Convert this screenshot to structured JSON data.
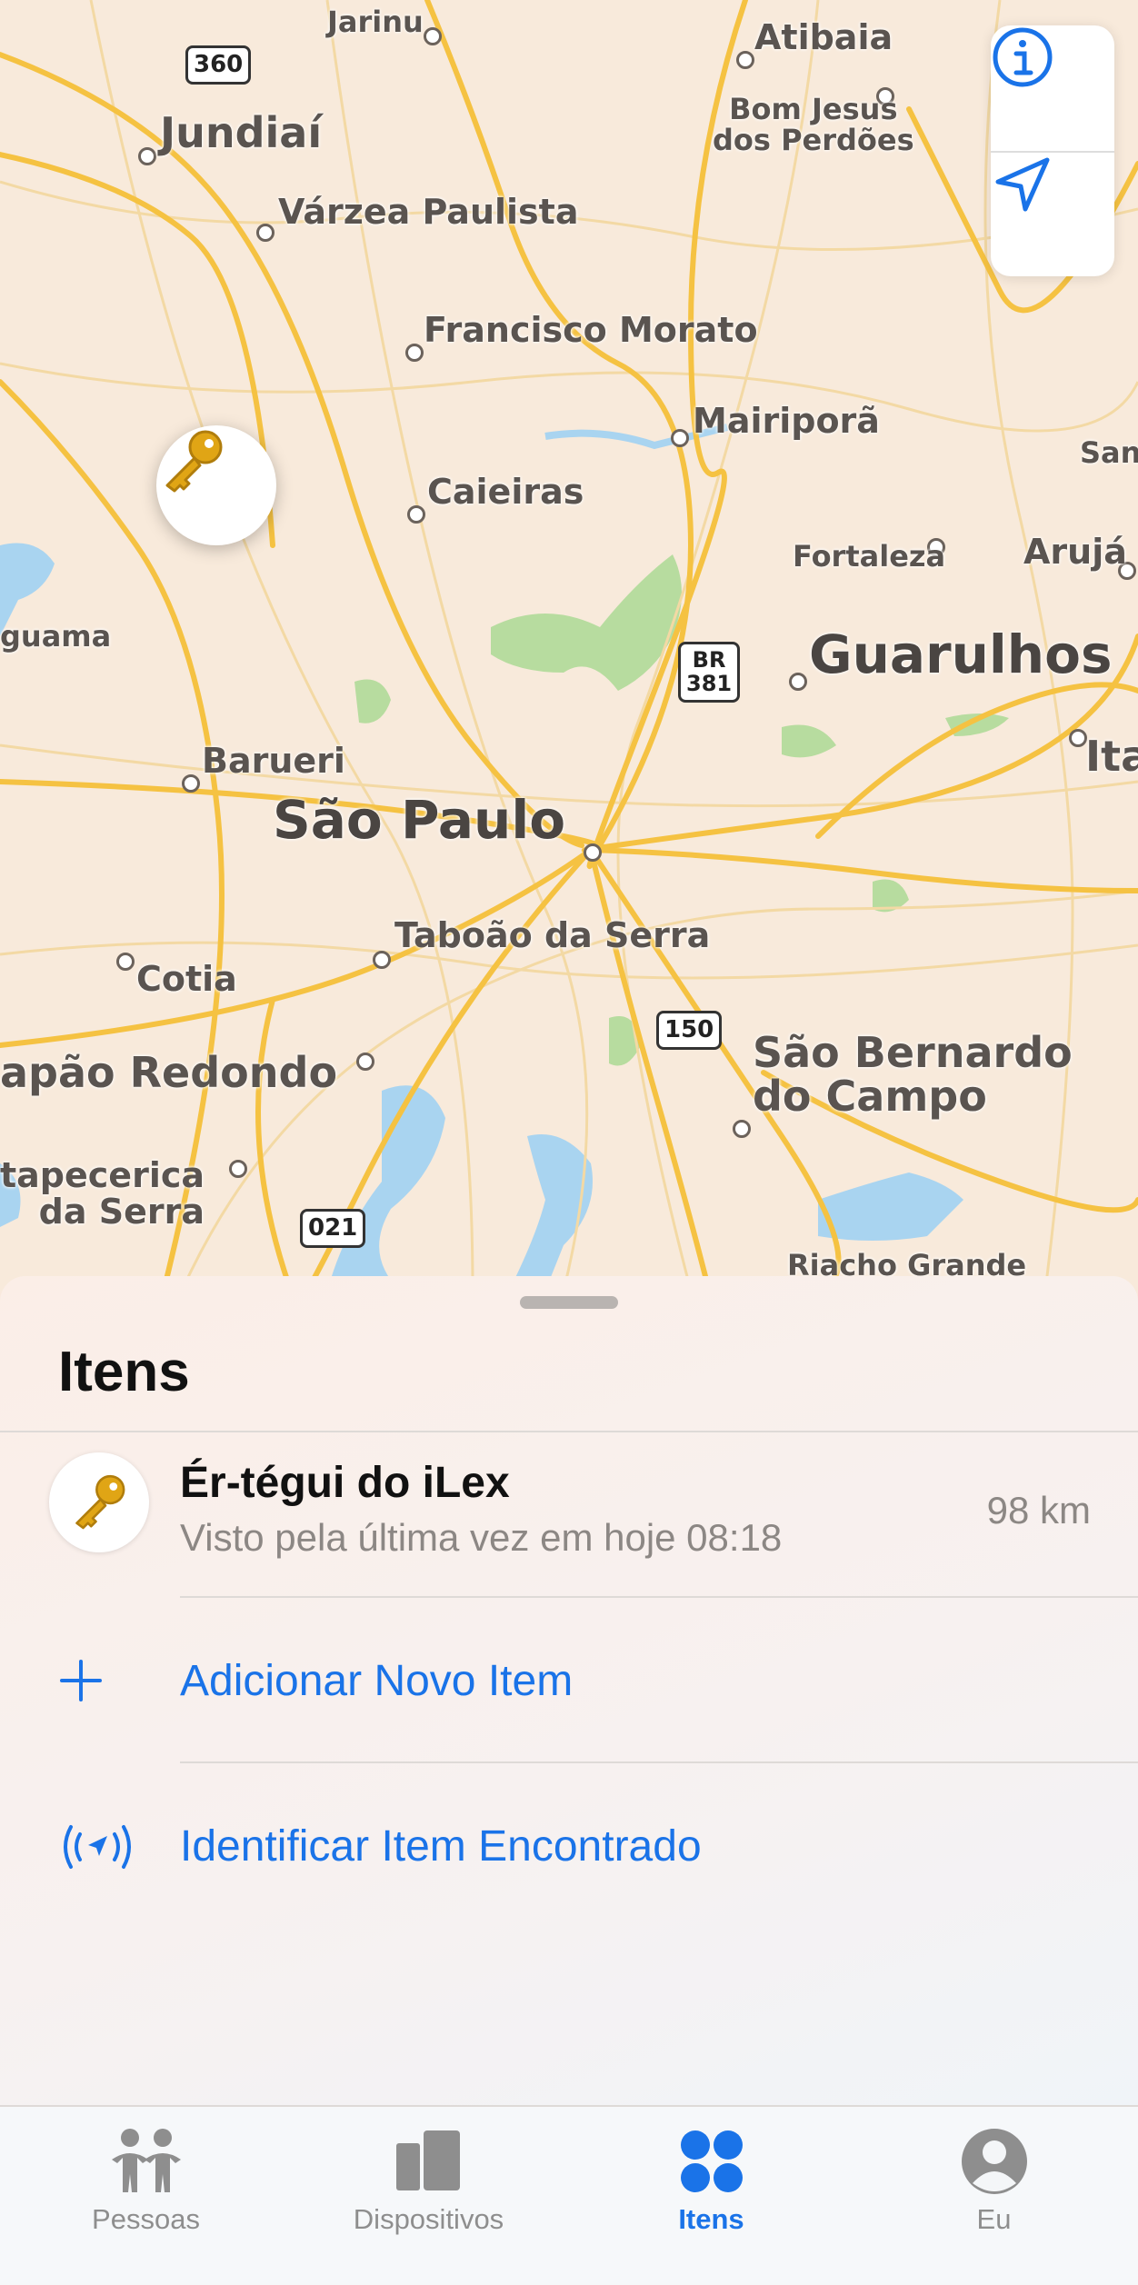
{
  "map": {
    "cities": [
      {
        "name": "Jarinu",
        "size": "s"
      },
      {
        "name": "Atibaia",
        "size": "m"
      },
      {
        "name": "Bom Jesus\ndos Perdões",
        "size": "s"
      },
      {
        "name": "Jundiaí",
        "size": "l"
      },
      {
        "name": "Várzea Paulista",
        "size": "m"
      },
      {
        "name": "Francisco Morato",
        "size": "m"
      },
      {
        "name": "Mairiporã",
        "size": "m"
      },
      {
        "name": "Caieiras",
        "size": "m"
      },
      {
        "name": "San",
        "size": "s"
      },
      {
        "name": "Fortaleza",
        "size": "s"
      },
      {
        "name": "Arujá",
        "size": "m"
      },
      {
        "name": "guama",
        "size": "s"
      },
      {
        "name": "Guarulhos",
        "size": "xl"
      },
      {
        "name": "Barueri",
        "size": "m"
      },
      {
        "name": "Ita",
        "size": "l"
      },
      {
        "name": "São Paulo",
        "size": "xl"
      },
      {
        "name": "Taboão da Serra",
        "size": "m"
      },
      {
        "name": "Cotia",
        "size": "m"
      },
      {
        "name": "apão Redondo",
        "size": "l"
      },
      {
        "name": "São Bernardo\ndo Campo",
        "size": "l"
      },
      {
        "name": "tapecerica\nda Serra",
        "size": "m"
      },
      {
        "name": "Riacho Grande",
        "size": "s"
      }
    ],
    "shields": [
      {
        "label": "360"
      },
      {
        "label": "BR\n381"
      },
      {
        "label": "150"
      },
      {
        "label": "021"
      }
    ],
    "controls": {
      "info_icon": "info-icon",
      "location_icon": "location-arrow-icon"
    },
    "pin_icon": "key-icon"
  },
  "sheet": {
    "title": "Itens",
    "item": {
      "name": "Ér-tégui do iLex",
      "subtitle": "Visto pela última vez em hoje 08:18",
      "distance": "98 km",
      "icon": "key-icon"
    },
    "actions": [
      {
        "label": "Adicionar Novo Item",
        "icon": "plus-icon"
      },
      {
        "label": "Identificar Item Encontrado",
        "icon": "broadcast-icon"
      }
    ]
  },
  "tabs": [
    {
      "label": "Pessoas",
      "icon": "people-icon"
    },
    {
      "label": "Dispositivos",
      "icon": "devices-icon"
    },
    {
      "label": "Itens",
      "icon": "items-icon",
      "active": true
    },
    {
      "label": "Eu",
      "icon": "person-circle-icon"
    }
  ],
  "colors": {
    "accent": "#1a73e8",
    "road": "#f5c242",
    "water": "#a9d4f0",
    "park": "#b7dc9f"
  }
}
